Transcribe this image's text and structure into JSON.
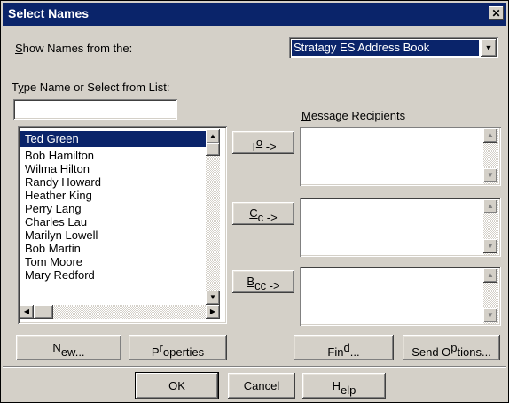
{
  "window": {
    "title": "Select Names",
    "close_glyph": "✕"
  },
  "show_names": {
    "label_mnemonic": "S",
    "label_rest": "how Names from the:",
    "selected": "Stratagy ES Address Book"
  },
  "type_name": {
    "label_pre": "T",
    "label_mnemonic": "y",
    "label_rest": "pe Name or Select from List:",
    "value": ""
  },
  "names_list": {
    "items": [
      "Ted Green",
      "Bob Hamilton",
      "Wilma Hilton",
      "Randy Howard",
      "Heather King",
      "Perry Lang",
      "Charles Lau",
      "Marilyn Lowell",
      "Bob Martin",
      "Tom Moore",
      "Mary Redford"
    ],
    "selected_index": 0
  },
  "recipients": {
    "label_mnemonic": "M",
    "label_rest": "essage Recipients",
    "to_button": {
      "pre": "T",
      "mnemonic": "o",
      "rest": " ->"
    },
    "cc_button": {
      "pre": "",
      "mnemonic": "C",
      "rest": "c ->"
    },
    "bcc_button": {
      "pre": "",
      "mnemonic": "B",
      "rest": "cc ->"
    }
  },
  "buttons": {
    "new": {
      "pre": "",
      "mnemonic": "N",
      "rest": "ew..."
    },
    "properties": {
      "pre": "P",
      "mnemonic": "r",
      "rest": "operties"
    },
    "find": {
      "pre": "Fin",
      "mnemonic": "d",
      "rest": "..."
    },
    "send_options": {
      "pre": "Send O",
      "mnemonic": "p",
      "rest": "tions..."
    },
    "ok": "OK",
    "cancel": "Cancel",
    "help": {
      "pre": "",
      "mnemonic": "H",
      "rest": "elp"
    }
  },
  "icons": {
    "up": "▲",
    "down": "▼",
    "left": "◀",
    "right": "▶"
  }
}
